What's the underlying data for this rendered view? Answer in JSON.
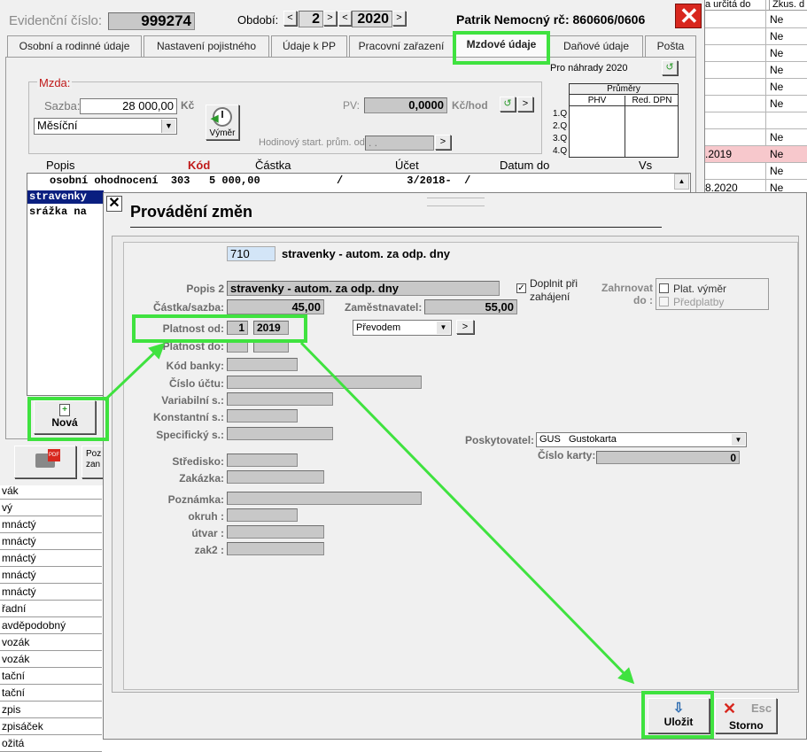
{
  "header": {
    "evid_label": "Evidenční číslo:",
    "evid_value": "999274",
    "obdobi_label": "Období:",
    "month": "2",
    "year": "2020",
    "person": "Patrik Nemocný rč: 860606/0606"
  },
  "tabs": [
    "Osobní a rodinné údaje",
    "Nastavení pojistného",
    "Údaje k PP",
    "Pracovní zařazení",
    "Mzdové údaje",
    "Daňové údaje",
    "Pošta"
  ],
  "mzda": {
    "section": "Mzda:",
    "sazba_label": "Sazba:",
    "sazba_value": "28 000,00",
    "sazba_unit": "Kč",
    "type": "Měsíční",
    "vymer": "Výměr",
    "pv_label": "PV:",
    "pv_value": "0,0000",
    "pv_unit": "Kč/hod",
    "hod_label": "Hodinový start. prům. od:",
    "hod_value": " .  .",
    "nahrady": "Pro náhrady 2020"
  },
  "averages": {
    "title": "Průměry",
    "col1": "PHV",
    "col2": "Red. DPN",
    "rows": [
      "1.Q",
      "2.Q",
      "3.Q",
      "4.Q"
    ]
  },
  "list": {
    "headers": [
      "Popis",
      "Kód",
      "Částka",
      "Účet",
      "Datum do",
      "Vs"
    ],
    "row1": "osobní ohodnocení  303   5 000,00            /          3/2018-  /",
    "items": [
      "stravenky",
      "srážka na"
    ]
  },
  "right_grid": {
    "headers": [
      "a určitá do",
      "Zkus. d"
    ],
    "col1": [
      "",
      "",
      "",
      "",
      "",
      "",
      "",
      "",
      ".2019",
      "",
      "8.2020"
    ],
    "col2": [
      "Ne",
      "Ne",
      "Ne",
      "Ne",
      "Ne",
      "Ne",
      "",
      "Ne",
      "Ne",
      "Ne",
      "Ne"
    ]
  },
  "left_list": [
    "vák",
    "vý",
    "mnáctý",
    "mnáctý",
    "mnáctý",
    "mnáctý",
    "mnáctý",
    "řadní",
    "avděpodobný",
    "vozák",
    "vozák",
    "tační",
    "tační",
    "zpis",
    "zpisáček",
    "ožitá"
  ],
  "nova": "Nová",
  "poz": "Poz zan",
  "dialog": {
    "title": "Provádění změn",
    "code": "710",
    "code_desc": "stravenky - autom. za odp. dny",
    "popis2_label": "Popis 2",
    "popis2": "stravenky - autom. za odp. dny",
    "doplnit": "Doplnit při zahájení",
    "zahrnovat": "Zahrnovat do :",
    "plat_vymer": "Plat. výměr",
    "predplatby": "Předplatby",
    "castka_label": "Částka/sazba:",
    "castka": "45,00",
    "zam_label": "Zaměstnavatel:",
    "zam": "55,00",
    "platnost_od_label": "Platnost od:",
    "platnost_od_m": "1",
    "platnost_od_y": "2019",
    "platnost_do_label": "Platnost do:",
    "prevodem": "Převodem",
    "kod_banky": "Kód banky:",
    "cislo_uctu": "Číslo účtu:",
    "variabilni": "Variabilní s.:",
    "konstantni": "Konstantní s.:",
    "specificky": "Specifický s.:",
    "stredisko": "Středisko:",
    "zakazka": "Zakázka:",
    "poznamka": "Poznámka:",
    "okruh": "okruh :",
    "utvar": "útvar :",
    "zak2": "zak2 :",
    "poskytovatel_label": "Poskytovatel:",
    "poskytovatel": "GUS   Gustokarta",
    "cislo_karty_label": "Číslo karty:",
    "cislo_karty": "0",
    "ulozit": "Uložit",
    "esc": "Esc",
    "storno": "Storno"
  }
}
